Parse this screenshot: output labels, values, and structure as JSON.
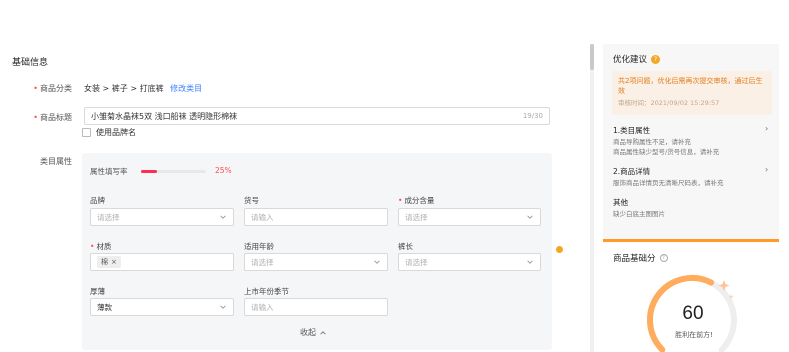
{
  "form": {
    "section_title": "基础信息",
    "category": {
      "label": "商品分类",
      "path": "女装 > 裤子 > 打底裤",
      "edit_link": "修改类目"
    },
    "product_title": {
      "label": "商品标题",
      "value": "小雏菊水晶袜5双 浅口船袜 透明隐形棉袜",
      "counter": "19/30"
    },
    "use_brand_name": "使用品牌名",
    "category_attrs": {
      "label": "类目属性",
      "fill_rate_label": "属性填写率",
      "fill_rate": 0.25,
      "fill_rate_text": "25%",
      "fields": [
        {
          "label": "品牌",
          "required": false,
          "placeholder": "请选择",
          "value": "",
          "kind": "select"
        },
        {
          "label": "货号",
          "required": false,
          "placeholder": "请输入",
          "value": "",
          "kind": "input"
        },
        {
          "label": "成分含量",
          "required": true,
          "placeholder": "请选择",
          "value": "",
          "kind": "select"
        },
        {
          "label": "材质",
          "required": true,
          "placeholder": "",
          "value": "",
          "tag": "棉",
          "kind": "tags"
        },
        {
          "label": "适用年龄",
          "required": false,
          "placeholder": "请选择",
          "value": "",
          "kind": "select"
        },
        {
          "label": "裤长",
          "required": false,
          "placeholder": "请选择",
          "value": "",
          "kind": "select"
        },
        {
          "label": "厚薄",
          "required": false,
          "placeholder": "",
          "value": "薄款",
          "kind": "select"
        },
        {
          "label": "上市年份季节",
          "required": false,
          "placeholder": "请输入",
          "value": "",
          "kind": "input"
        }
      ],
      "collapse_label": "收起"
    }
  },
  "advice": {
    "title": "优化建议",
    "badge": "?",
    "alert_message": "共2项问题，优化后需再次提交审核，通过后生效",
    "alert_time": "审核时间：2021/09/02 15:29:57",
    "items": [
      {
        "title": "1.类目属性",
        "lines": [
          "商品导购属性不足，请补充",
          "商品属性缺少型号/货号信息，请补充"
        ],
        "has_arrow": true
      },
      {
        "title": "2.商品详情",
        "lines": [
          "服饰商品详情页无清晰尺码表，请补充"
        ],
        "has_arrow": true
      },
      {
        "title": "其他",
        "lines": [
          "缺少白底主图图片"
        ],
        "has_arrow": false
      }
    ]
  },
  "score": {
    "title": "商品基础分",
    "help": "?",
    "value": "60",
    "subtitle": "胜利在前方!",
    "fraction": 0.6
  },
  "colors": {
    "accent": "#ff9b26",
    "progress": "#ff2d55",
    "link": "#3d7fff",
    "warn": "#f5a623"
  }
}
